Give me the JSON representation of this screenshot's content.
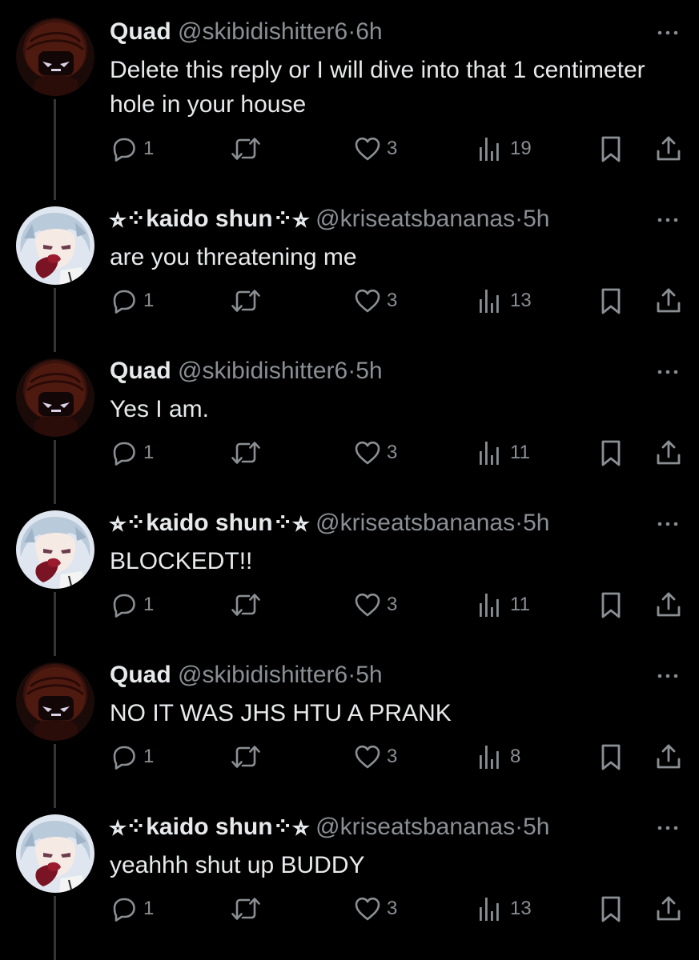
{
  "colors": {
    "background": "#000000",
    "text_primary": "#e7e9ea",
    "text_secondary": "#8b8f94",
    "thread_line": "#333639"
  },
  "tweets": [
    {
      "name": "Quad",
      "handle": "@skibidishitter6",
      "separator": "·",
      "time": "6h",
      "text": "Delete this reply or I will dive into that 1 centimeter hole in your house",
      "replies": "1",
      "likes": "3",
      "views": "19",
      "avatar": "dark-hooded-character-avatar"
    },
    {
      "name": "⭐︎⁘kaido shun⁘⭐︎",
      "handle": "@kriseatsbananas",
      "separator": "·",
      "time": "5h",
      "text": "are you threatening me",
      "replies": "1",
      "likes": "3",
      "views": "13",
      "avatar": "white-haired-anime-avatar"
    },
    {
      "name": "Quad",
      "handle": "@skibidishitter6",
      "separator": "·",
      "time": "5h",
      "text": "Yes I am.",
      "replies": "1",
      "likes": "3",
      "views": "11",
      "avatar": "dark-hooded-character-avatar"
    },
    {
      "name": "⭐︎⁘kaido shun⁘⭐︎",
      "handle": "@kriseatsbananas",
      "separator": "·",
      "time": "5h",
      "text": "BLOCKEDT!!",
      "replies": "1",
      "likes": "3",
      "views": "11",
      "avatar": "white-haired-anime-avatar"
    },
    {
      "name": "Quad",
      "handle": "@skibidishitter6",
      "separator": "·",
      "time": "5h",
      "text": "NO IT WAS JHS HTU A PRANK",
      "replies": "1",
      "likes": "3",
      "views": "8",
      "avatar": "dark-hooded-character-avatar"
    },
    {
      "name": "⭐︎⁘kaido shun⁘⭐︎",
      "handle": "@kriseatsbananas",
      "separator": "·",
      "time": "5h",
      "text": "yeahhh shut up BUDDY",
      "replies": "1",
      "likes": "3",
      "views": "13",
      "avatar": "white-haired-anime-avatar"
    }
  ]
}
